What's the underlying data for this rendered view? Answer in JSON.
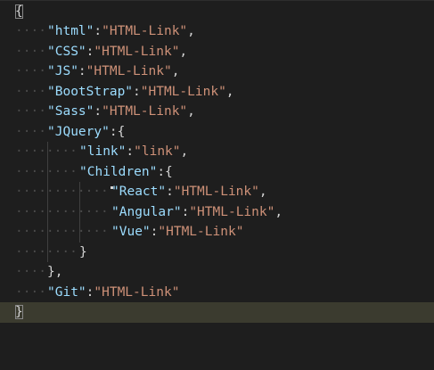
{
  "editor": {
    "lines": [
      {
        "indent": 0,
        "tokens": [
          {
            "t": "brace",
            "v": "{"
          }
        ],
        "bracket_match": true
      },
      {
        "indent": 1,
        "tokens": [
          {
            "t": "key",
            "v": "\"html\""
          },
          {
            "t": "punct",
            "v": ":"
          },
          {
            "t": "str",
            "v": "\"HTML-Link\""
          },
          {
            "t": "punct",
            "v": ","
          }
        ]
      },
      {
        "indent": 1,
        "tokens": [
          {
            "t": "key",
            "v": "\"CSS\""
          },
          {
            "t": "punct",
            "v": ":"
          },
          {
            "t": "str",
            "v": "\"HTML-Link\""
          },
          {
            "t": "punct",
            "v": ","
          }
        ]
      },
      {
        "indent": 1,
        "tokens": [
          {
            "t": "key",
            "v": "\"JS\""
          },
          {
            "t": "punct",
            "v": ":"
          },
          {
            "t": "str",
            "v": "\"HTML-Link\""
          },
          {
            "t": "punct",
            "v": ","
          }
        ]
      },
      {
        "indent": 1,
        "tokens": [
          {
            "t": "key",
            "v": "\"BootStrap\""
          },
          {
            "t": "punct",
            "v": ":"
          },
          {
            "t": "str",
            "v": "\"HTML-Link\""
          },
          {
            "t": "punct",
            "v": ","
          }
        ]
      },
      {
        "indent": 1,
        "tokens": [
          {
            "t": "key",
            "v": "\"Sass\""
          },
          {
            "t": "punct",
            "v": ":"
          },
          {
            "t": "str",
            "v": "\"HTML-Link\""
          },
          {
            "t": "punct",
            "v": ","
          }
        ]
      },
      {
        "indent": 1,
        "tokens": [
          {
            "t": "key",
            "v": "\"JQuery\""
          },
          {
            "t": "punct",
            "v": ":"
          },
          {
            "t": "brace",
            "v": "{"
          }
        ]
      },
      {
        "indent": 2,
        "tokens": [
          {
            "t": "key",
            "v": "\"link\""
          },
          {
            "t": "punct",
            "v": ":"
          },
          {
            "t": "str",
            "v": "\"link\""
          },
          {
            "t": "punct",
            "v": ","
          }
        ]
      },
      {
        "indent": 2,
        "tokens": [
          {
            "t": "key",
            "v": "\"Children\""
          },
          {
            "t": "punct",
            "v": ":"
          },
          {
            "t": "brace",
            "v": "{"
          }
        ]
      },
      {
        "indent": 3,
        "tokens": [
          {
            "t": "key",
            "v": "\"React\""
          },
          {
            "t": "punct",
            "v": ":"
          },
          {
            "t": "str",
            "v": "\"HTML-Link\""
          },
          {
            "t": "punct",
            "v": ","
          }
        ]
      },
      {
        "indent": 3,
        "tokens": [
          {
            "t": "key",
            "v": "\"Angular\""
          },
          {
            "t": "punct",
            "v": ":"
          },
          {
            "t": "str",
            "v": "\"HTML-Link\""
          },
          {
            "t": "punct",
            "v": ","
          }
        ]
      },
      {
        "indent": 3,
        "tokens": [
          {
            "t": "key",
            "v": "\"Vue\""
          },
          {
            "t": "punct",
            "v": ":"
          },
          {
            "t": "str",
            "v": "\"HTML-Link\""
          }
        ]
      },
      {
        "indent": 2,
        "tokens": [
          {
            "t": "brace",
            "v": "}"
          }
        ]
      },
      {
        "indent": 1,
        "tokens": [
          {
            "t": "brace",
            "v": "}"
          },
          {
            "t": "punct",
            "v": ","
          }
        ]
      },
      {
        "indent": 1,
        "tokens": [
          {
            "t": "key",
            "v": "\"Git\""
          },
          {
            "t": "punct",
            "v": ":"
          },
          {
            "t": "str",
            "v": "\"HTML-Link\""
          }
        ]
      },
      {
        "indent": 0,
        "tokens": [
          {
            "t": "brace",
            "v": "}"
          }
        ],
        "bracket_match": true,
        "current": true
      }
    ]
  },
  "colors": {
    "background": "#1e1e1e",
    "key": "#9cdcfe",
    "string": "#ce9178",
    "punctuation": "#d4d4d4",
    "current_line": "#3b3b2f",
    "whitespace_dots": "#4a4a4a",
    "indent_guide": "#404040"
  }
}
